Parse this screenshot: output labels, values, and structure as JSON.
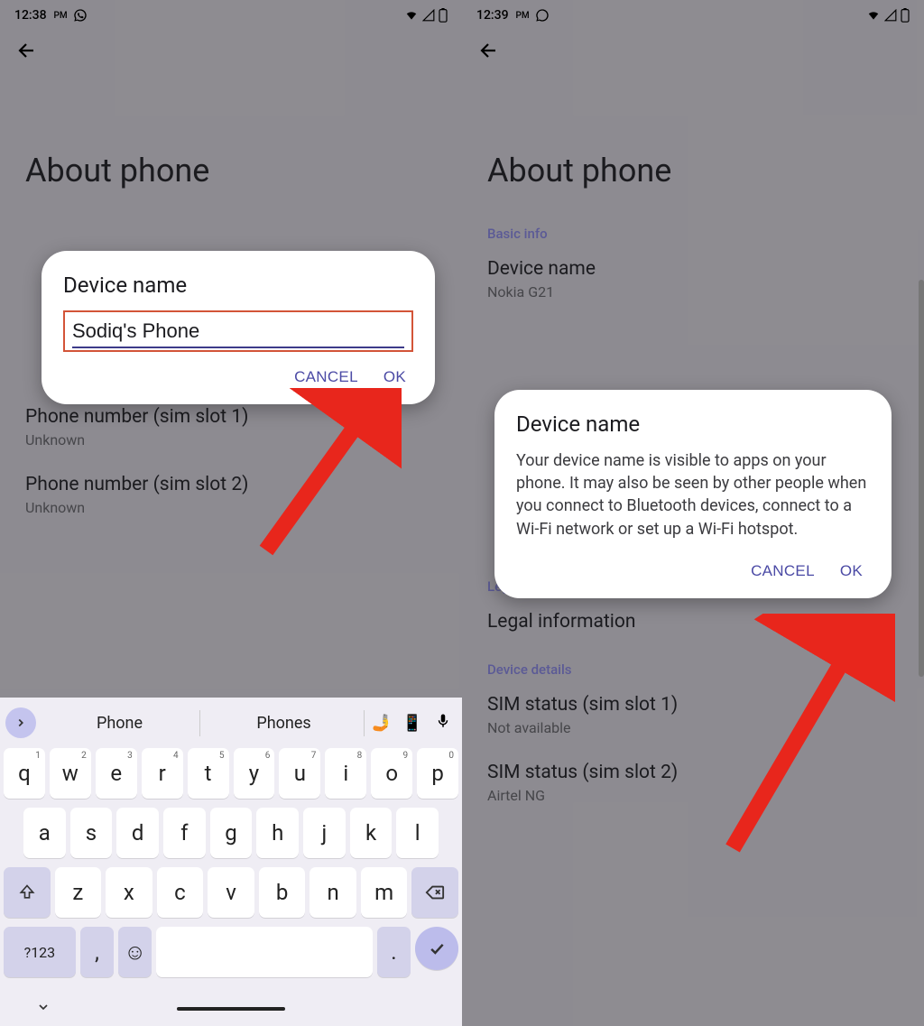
{
  "left": {
    "status": {
      "time": "12:38",
      "pm": "PM"
    },
    "page_title": "About phone",
    "dialog": {
      "title": "Device name",
      "input_value": "Sodiq's Phone",
      "cancel": "CANCEL",
      "ok": "OK"
    },
    "bg_items": [
      {
        "title": "Phone number (sim slot 1)",
        "sub": "Unknown"
      },
      {
        "title": "Phone number (sim slot 2)",
        "sub": "Unknown"
      }
    ],
    "keyboard": {
      "suggestions": [
        "Phone",
        "Phones"
      ],
      "row1": [
        {
          "k": "q",
          "n": "1"
        },
        {
          "k": "w",
          "n": "2"
        },
        {
          "k": "e",
          "n": "3"
        },
        {
          "k": "r",
          "n": "4"
        },
        {
          "k": "t",
          "n": "5"
        },
        {
          "k": "y",
          "n": "6"
        },
        {
          "k": "u",
          "n": "7"
        },
        {
          "k": "i",
          "n": "8"
        },
        {
          "k": "o",
          "n": "9"
        },
        {
          "k": "p",
          "n": "0"
        }
      ],
      "row2": [
        "a",
        "s",
        "d",
        "f",
        "g",
        "h",
        "j",
        "k",
        "l"
      ],
      "row3": [
        "z",
        "x",
        "c",
        "v",
        "b",
        "n",
        "m"
      ],
      "sym": "?123",
      "comma": ",",
      "period": "."
    }
  },
  "right": {
    "status": {
      "time": "12:39",
      "pm": "PM"
    },
    "page_title": "About phone",
    "sections": {
      "basic_info": "Basic info",
      "device_name": {
        "title": "Device name",
        "sub": "Nokia G21"
      },
      "legal_reg": "Legal & regulatory",
      "legal_info": "Legal information",
      "device_details": "Device details",
      "sim1": {
        "title": "SIM status (sim slot 1)",
        "sub": "Not available"
      },
      "sim2": {
        "title": "SIM status (sim slot 2)",
        "sub": "Airtel NG"
      }
    },
    "dialog": {
      "title": "Device name",
      "body": "Your device name is visible to apps on your phone. It may also be seen by other people when you connect to Bluetooth devices, connect to a Wi-Fi network or set up a Wi-Fi hotspot.",
      "cancel": "CANCEL",
      "ok": "OK"
    }
  }
}
